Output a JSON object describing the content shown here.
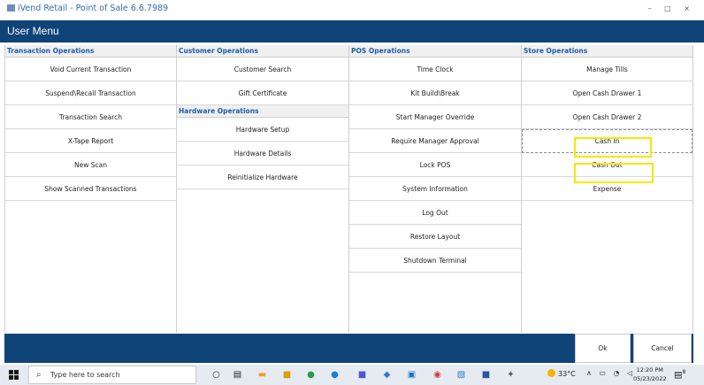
{
  "window": {
    "title": "iVend Retail - Point of Sale 6.6.7989",
    "controls": "– □ ×"
  },
  "header": {
    "title": "User Menu"
  },
  "columns": {
    "transaction": {
      "heading": "Transaction Operations",
      "items": [
        "Void Current Transaction",
        "Suspend\\Recall Transaction",
        "Transaction Search",
        "X-Tape Report",
        "New Scan",
        "Show Scanned Transactions"
      ]
    },
    "customer": {
      "heading": "Customer Operations",
      "items": [
        "Customer Search",
        "Gift Certificate"
      ]
    },
    "hardware": {
      "heading": "Hardware Operations",
      "items": [
        "Hardware Setup",
        "Hardware Details",
        "Reinitialize Hardware"
      ]
    },
    "pos": {
      "heading": "POS Operations",
      "items": [
        "Time Clock",
        "Kit Build\\Break",
        "Start Manager Override",
        "Require Manager Approval",
        "Lock POS",
        "System Information",
        "Log Out",
        "Restore Layout",
        "Shutdown Terminal"
      ]
    },
    "store": {
      "heading": "Store Operations",
      "items": [
        "Manage Tills",
        "Open Cash Drawer 1",
        "Open Cash Drawer 2",
        "Cash In",
        "Cash Out",
        "Expense"
      ]
    }
  },
  "footer": {
    "ok_label": "Ok",
    "cancel_label": "Cancel"
  },
  "taskbar": {
    "search_placeholder": "Type here to search",
    "temperature": "33°C",
    "time": "12:20 PM",
    "date": "05/23/2022",
    "notification_count": "8"
  },
  "colors": {
    "header_bg": "#0f4479",
    "section_heading": "#1f5ea8",
    "highlight": "#f5e800"
  }
}
